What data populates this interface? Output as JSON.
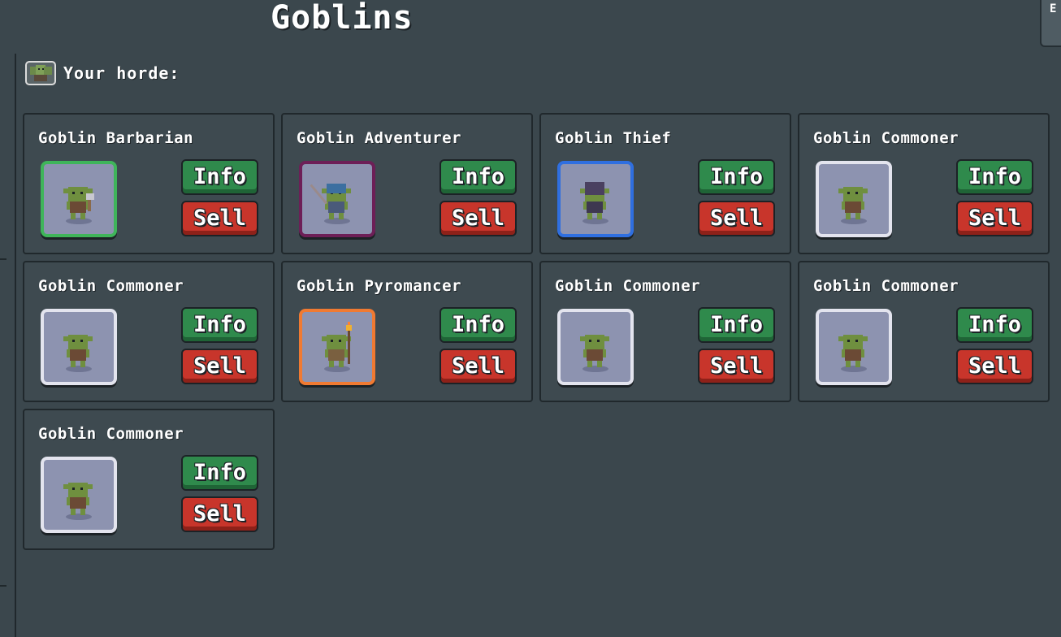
{
  "title": "Goblins",
  "corner_button": {
    "label": "E"
  },
  "horde": {
    "label": "Your horde:",
    "icon": "goblin-group-icon"
  },
  "goblins": [
    {
      "name": "Goblin Barbarian",
      "rarity_color": "#3fb55a",
      "sprite": "goblin-barbarian-icon",
      "info_label": "Info",
      "sell_label": "Sell"
    },
    {
      "name": "Goblin Adventurer",
      "rarity_color": "#6d1f57",
      "sprite": "goblin-adventurer-icon",
      "info_label": "Info",
      "sell_label": "Sell"
    },
    {
      "name": "Goblin Thief",
      "rarity_color": "#2f6fe0",
      "sprite": "goblin-thief-icon",
      "info_label": "Info",
      "sell_label": "Sell"
    },
    {
      "name": "Goblin Commoner",
      "rarity_color": "#e3e4ee",
      "sprite": "goblin-commoner-icon",
      "info_label": "Info",
      "sell_label": "Sell"
    },
    {
      "name": "Goblin Commoner",
      "rarity_color": "#e3e4ee",
      "sprite": "goblin-commoner-icon",
      "info_label": "Info",
      "sell_label": "Sell"
    },
    {
      "name": "Goblin Pyromancer",
      "rarity_color": "#f07a32",
      "sprite": "goblin-pyromancer-icon",
      "info_label": "Info",
      "sell_label": "Sell"
    },
    {
      "name": "Goblin Commoner",
      "rarity_color": "#e3e4ee",
      "sprite": "goblin-commoner-icon",
      "info_label": "Info",
      "sell_label": "Sell"
    },
    {
      "name": "Goblin Commoner",
      "rarity_color": "#e3e4ee",
      "sprite": "goblin-commoner-icon",
      "info_label": "Info",
      "sell_label": "Sell"
    },
    {
      "name": "Goblin Commoner",
      "rarity_color": "#e3e4ee",
      "sprite": "goblin-commoner-icon",
      "info_label": "Info",
      "sell_label": "Sell"
    }
  ]
}
